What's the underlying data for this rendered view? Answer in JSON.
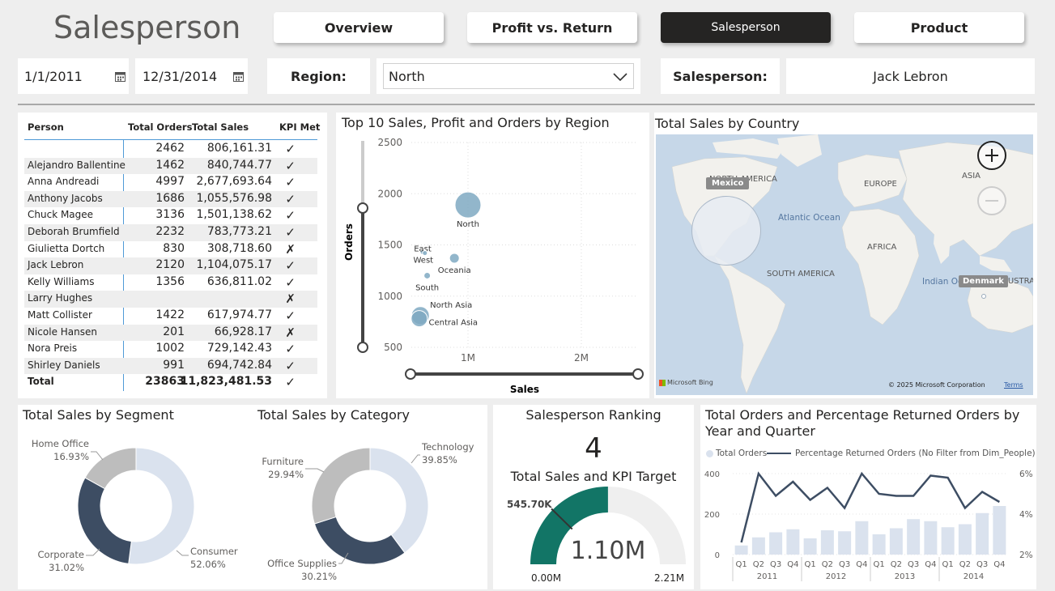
{
  "page_title": "Salesperson",
  "nav": [
    {
      "label": "Overview",
      "active": false
    },
    {
      "label": "Profit vs. Return",
      "active": false
    },
    {
      "label": "Salesperson",
      "active": true
    },
    {
      "label": "Product",
      "active": false
    }
  ],
  "filters": {
    "start_date": "1/1/2011",
    "end_date": "12/31/2014",
    "region_label": "Region:",
    "region_value": "North",
    "salesperson_label": "Salesperson:",
    "salesperson_value": "Jack Lebron"
  },
  "kpi_table": {
    "headers": [
      "Person",
      "Total Orders",
      "Total Sales",
      "KPI Met"
    ],
    "rows": [
      {
        "person": "",
        "orders": "2462",
        "sales": "806,161.31",
        "kpi": "✓"
      },
      {
        "person": "Alejandro Ballentine",
        "orders": "1462",
        "sales": "840,744.77",
        "kpi": "✓"
      },
      {
        "person": "Anna Andreadi",
        "orders": "4997",
        "sales": "2,677,693.64",
        "kpi": "✓"
      },
      {
        "person": "Anthony Jacobs",
        "orders": "1686",
        "sales": "1,055,576.98",
        "kpi": "✓"
      },
      {
        "person": "Chuck Magee",
        "orders": "3136",
        "sales": "1,501,138.62",
        "kpi": "✓"
      },
      {
        "person": "Deborah Brumfield",
        "orders": "2232",
        "sales": "783,773.21",
        "kpi": "✓"
      },
      {
        "person": "Giulietta Dortch",
        "orders": "830",
        "sales": "308,718.60",
        "kpi": "✗"
      },
      {
        "person": "Jack Lebron",
        "orders": "2120",
        "sales": "1,104,075.17",
        "kpi": "✓"
      },
      {
        "person": "Kelly Williams",
        "orders": "1356",
        "sales": "636,811.02",
        "kpi": "✓"
      },
      {
        "person": "Larry Hughes",
        "orders": "",
        "sales": "",
        "kpi": "✗"
      },
      {
        "person": "Matt Collister",
        "orders": "1422",
        "sales": "617,974.77",
        "kpi": "✓"
      },
      {
        "person": "Nicole Hansen",
        "orders": "201",
        "sales": "66,928.17",
        "kpi": "✗"
      },
      {
        "person": "Nora Preis",
        "orders": "1002",
        "sales": "729,142.43",
        "kpi": "✓"
      },
      {
        "person": "Shirley Daniels",
        "orders": "991",
        "sales": "694,742.84",
        "kpi": "✓"
      }
    ],
    "total": {
      "person": "Total",
      "orders": "23863",
      "sales": "11,823,481.53",
      "kpi": "✓"
    }
  },
  "scatter_title": "Top 10 Sales, Profit and Orders by Region",
  "map": {
    "title": "Total Sales by Country",
    "labels": [
      "NORTH AMERICA",
      "EUROPE",
      "ASIA",
      "Atlantic Ocean",
      "AFRICA",
      "SOUTH AMERICA",
      "Indian Oc",
      "AUSTRAL"
    ],
    "tooltip_mexico": "Mexico",
    "tooltip_denmark": "Denmark",
    "attribution": "© 2025 Microsoft Corporation",
    "terms": "Terms",
    "bing": "Microsoft Bing"
  },
  "segment": {
    "title": "Total Sales by Segment"
  },
  "category": {
    "title": "Total Sales by Category"
  },
  "ranking": {
    "title": "Salesperson Ranking",
    "rank": "4",
    "gauge_title": "Total Sales and KPI Target",
    "gauge_value": "1.10M",
    "target_label": "545.70K",
    "min_label": "0.00M",
    "max_label": "2.21M"
  },
  "combo": {
    "title_line1": "Total Orders and Percentage Returned Orders by",
    "title_line2": "Year and Quarter",
    "legend_bar": "Total Orders",
    "legend_line": "Percentage Returned Orders (No Filter from Dim_People)"
  },
  "colors": {
    "dark": "#3d4d63",
    "light": "#dae2ee",
    "grey": "#bdbdbd",
    "teal": "#127566",
    "bubble": "#7fa9c2",
    "map_water": "#c6d7e8",
    "map_land": "#f2f1ed"
  },
  "chart_data": [
    {
      "type": "scatter",
      "title": "Top 10 Sales, Profit and Orders by Region",
      "xlabel": "Sales",
      "ylabel": "Orders",
      "xticks": [
        "1M",
        "2M"
      ],
      "yticks": [
        500,
        1000,
        1500,
        2000,
        2500
      ],
      "ylim": [
        500,
        2500
      ],
      "xlim": [
        0.5,
        2.5
      ],
      "points": [
        {
          "label": "North",
          "x": 1.0,
          "y": 1890,
          "size": 16
        },
        {
          "label": "Oceania",
          "x": 0.88,
          "y": 1370,
          "size": 6
        },
        {
          "label": "East",
          "x": 0.6,
          "y": 1430,
          "size": 3
        },
        {
          "label": "West",
          "x": 0.62,
          "y": 1420,
          "size": 3
        },
        {
          "label": "South",
          "x": 0.64,
          "y": 1200,
          "size": 4
        },
        {
          "label": "North Asia",
          "x": 0.58,
          "y": 810,
          "size": 11
        },
        {
          "label": "Central Asia",
          "x": 0.57,
          "y": 780,
          "size": 10
        }
      ]
    },
    {
      "type": "pie",
      "title": "Total Sales by Segment",
      "slices": [
        {
          "name": "Consumer",
          "value": 52.06,
          "label": "52.06%",
          "color": "#dae2ee"
        },
        {
          "name": "Corporate",
          "value": 31.02,
          "label": "31.02%",
          "color": "#3d4d63"
        },
        {
          "name": "Home Office",
          "value": 16.93,
          "label": "16.93%",
          "color": "#bdbdbd"
        }
      ]
    },
    {
      "type": "pie",
      "title": "Total Sales by Category",
      "slices": [
        {
          "name": "Technology",
          "value": 39.85,
          "label": "39.85%",
          "color": "#dae2ee"
        },
        {
          "name": "Office Supplies",
          "value": 30.21,
          "label": "30.21%",
          "color": "#3d4d63"
        },
        {
          "name": "Furniture",
          "value": 29.94,
          "label": "29.94%",
          "color": "#bdbdbd"
        }
      ]
    },
    {
      "type": "bar",
      "title": "Total Orders and Percentage Returned Orders by Year and Quarter",
      "categories": [
        "Q1",
        "Q2",
        "Q3",
        "Q4",
        "Q1",
        "Q2",
        "Q3",
        "Q4",
        "Q1",
        "Q2",
        "Q3",
        "Q4",
        "Q1",
        "Q2",
        "Q3",
        "Q4"
      ],
      "years": [
        "2011",
        "2012",
        "2013",
        "2014"
      ],
      "series": [
        {
          "name": "Total Orders",
          "kind": "bar",
          "values": [
            45,
            85,
            110,
            125,
            80,
            120,
            115,
            165,
            100,
            130,
            175,
            165,
            135,
            150,
            205,
            240
          ]
        },
        {
          "name": "Percentage Returned Orders (No Filter from Dim_People)",
          "kind": "line",
          "values": [
            2.6,
            6.0,
            4.9,
            5.6,
            4.7,
            5.3,
            4.3,
            6.0,
            5.0,
            4.9,
            4.9,
            5.9,
            5.8,
            4.3,
            5.1,
            4.6
          ]
        }
      ],
      "ylim": [
        0,
        400
      ],
      "yticks": [
        0,
        200,
        400
      ],
      "y2lim": [
        2,
        6
      ],
      "y2ticks": [
        "2%",
        "4%",
        "6%"
      ]
    }
  ]
}
